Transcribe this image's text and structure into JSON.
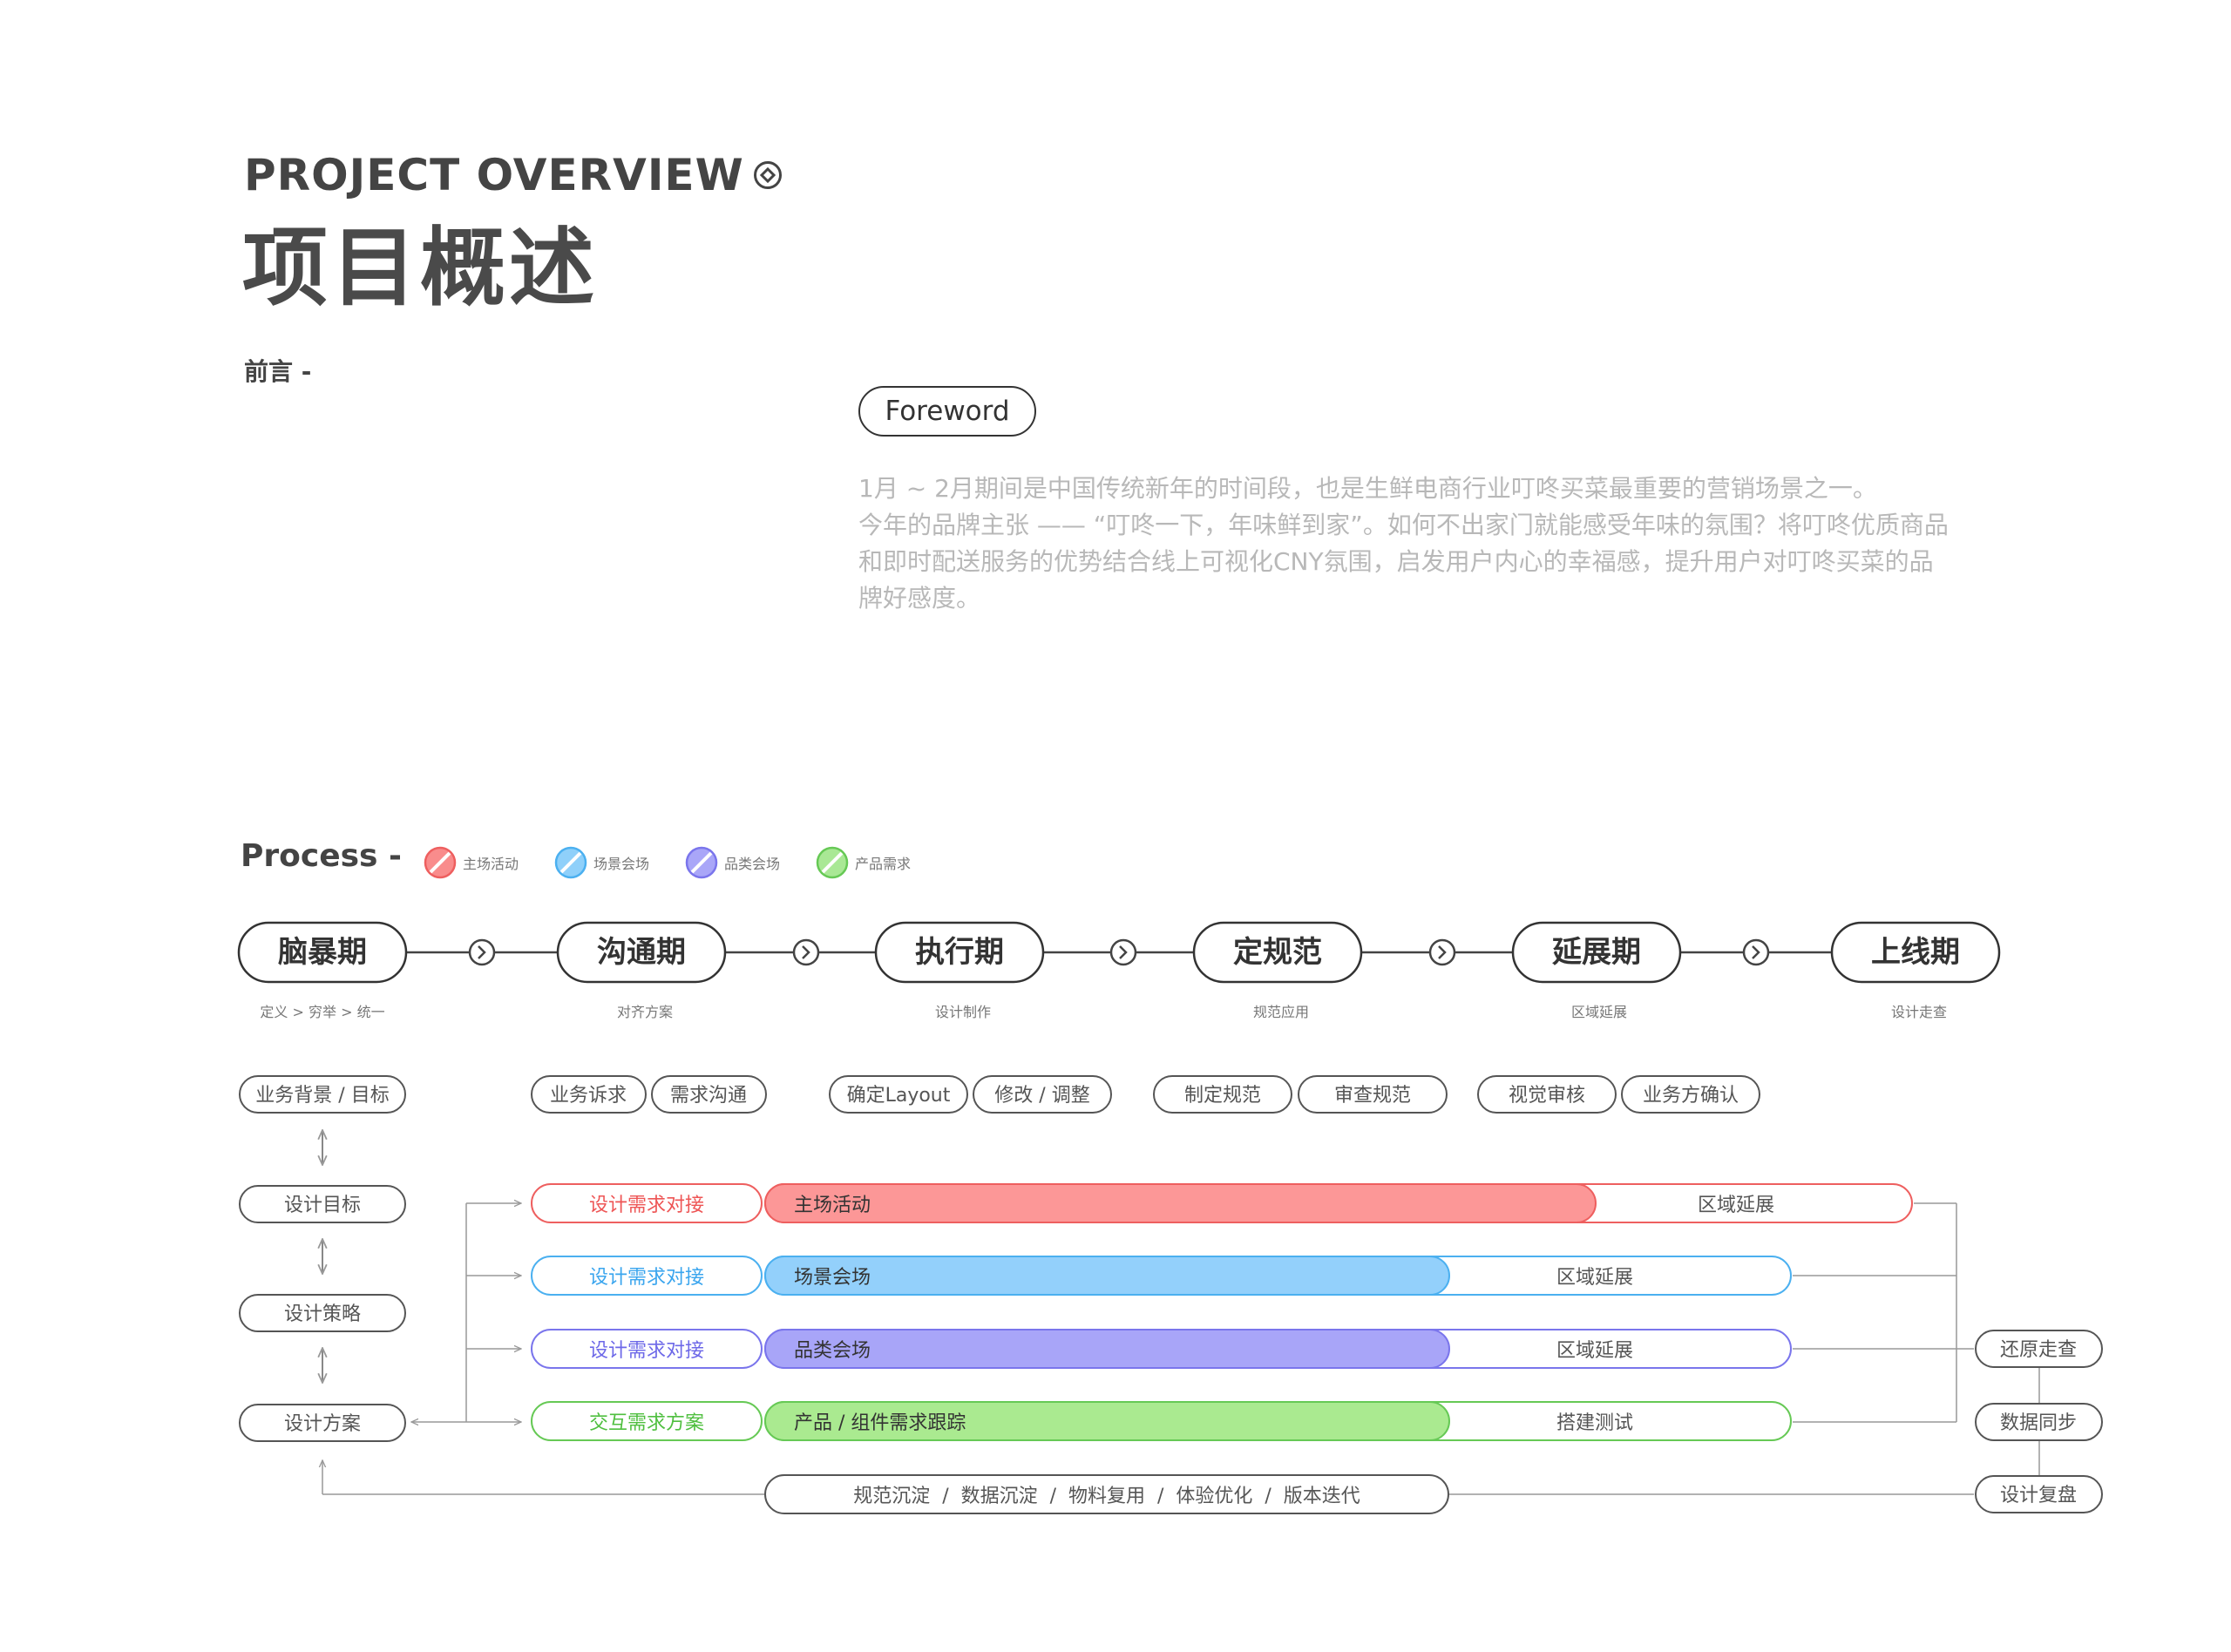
{
  "header": {
    "title_en": "PROJECT OVERVIEW",
    "title_cn": "项目概述",
    "preface_label": "前言 -"
  },
  "foreword": {
    "label": "Foreword",
    "paragraph_lines": [
      "1月 ~ 2月期间是中国传统新年的时间段，也是生鲜电商行业叮咚买菜最重要的营销场景之一。",
      "今年的品牌主张 —— “叮咚一下，年味鲜到家”。如何不出家门就能感受年味的氛围？将叮咚优质商品",
      "和即时配送服务的优势结合线上可视化CNY氛围，启发用户内心的幸福感，提升用户对叮咚买菜的品",
      "牌好感度。"
    ]
  },
  "process": {
    "title": "Process -",
    "legend": [
      {
        "label": "主场活动",
        "color": "#f98c8c",
        "stroke": "#f06666"
      },
      {
        "label": "场景会场",
        "color": "#8fd0fa",
        "stroke": "#4fb0f0"
      },
      {
        "label": "品类会场",
        "color": "#a9a6f8",
        "stroke": "#7d78ee"
      },
      {
        "label": "产品需求",
        "color": "#a9e895",
        "stroke": "#66cc55"
      }
    ],
    "phases": [
      {
        "name": "脑暴期",
        "sub": "定义  >  穷举  >  统一",
        "tasks": [
          "业务背景 / 目标"
        ]
      },
      {
        "name": "沟通期",
        "sub": "对齐方案",
        "tasks": [
          "业务诉求",
          "需求沟通"
        ]
      },
      {
        "name": "执行期",
        "sub": "设计制作",
        "tasks": [
          "确定Layout",
          "修改 / 调整"
        ]
      },
      {
        "name": "定规范",
        "sub": "规范应用",
        "tasks": [
          "制定规范",
          "审查规范"
        ]
      },
      {
        "name": "延展期",
        "sub": "区域延展",
        "tasks": [
          "视觉审核",
          "业务方确认"
        ]
      },
      {
        "name": "上线期",
        "sub": "设计走查",
        "tasks": []
      }
    ],
    "left_chain": [
      "设计目标",
      "设计策略",
      "设计方案"
    ],
    "tracks": [
      {
        "start": "设计需求对接",
        "main": "主场活动",
        "end": "区域延展",
        "color": "#fc9797",
        "stroke": "#ee5f5f",
        "start_text_color": "#ee5555"
      },
      {
        "start": "设计需求对接",
        "main": "场景会场",
        "end": "区域延展",
        "color": "#93d0fb",
        "stroke": "#4bb0f0",
        "start_text_color": "#3aa5ee"
      },
      {
        "start": "设计需求对接",
        "main": "品类会场",
        "end": "区域延展",
        "color": "#a8a5f8",
        "stroke": "#7a75ec",
        "start_text_color": "#6d68e8"
      },
      {
        "start": "交互需求方案",
        "main": "产品 / 组件需求跟踪",
        "end": "搭建测试",
        "color": "#aaea90",
        "stroke": "#66c955",
        "start_text_color": "#4fbf3f"
      }
    ],
    "bottom_bar": "规范沉淀  /  数据沉淀  /  物料复用  /  体验优化  /  版本迭代",
    "right_chain": [
      "还原走查",
      "数据同步",
      "设计复盘"
    ]
  }
}
